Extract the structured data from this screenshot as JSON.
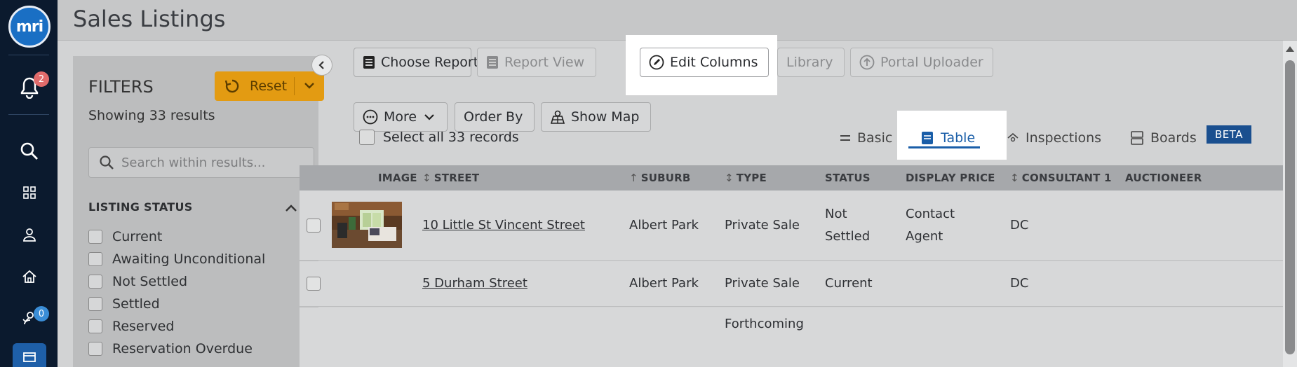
{
  "app": {
    "logo_text": "mri",
    "notification_count": "2",
    "tasks_count": "0"
  },
  "header": {
    "title": "Sales Listings"
  },
  "filters": {
    "title": "FILTERS",
    "reset_label": "Reset",
    "result_count": "Showing 33 results",
    "search_placeholder": "Search within results...",
    "section_title": "LISTING STATUS",
    "options": [
      {
        "label": "Current",
        "checked": false
      },
      {
        "label": "Awaiting Unconditional",
        "checked": false
      },
      {
        "label": "Not Settled",
        "checked": false
      },
      {
        "label": "Settled",
        "checked": false
      },
      {
        "label": "Reserved",
        "checked": false
      },
      {
        "label": "Reservation Overdue",
        "checked": false
      }
    ]
  },
  "toolbar": {
    "choose_report": "Choose Report",
    "report_view": "Report View",
    "edit_columns": "Edit Columns",
    "library": "Library",
    "portal_uploader": "Portal Uploader",
    "more": "More",
    "order_by": "Order By",
    "show_map": "Show Map"
  },
  "selection": {
    "select_all_label": "Select all 33 records"
  },
  "views": {
    "basic": "Basic",
    "table": "Table",
    "inspections": "Inspections",
    "boards": "Boards",
    "beta_badge": "BETA",
    "active": "Table"
  },
  "table": {
    "columns": [
      "IMAGE",
      "STREET",
      "SUBURB",
      "TYPE",
      "STATUS",
      "DISPLAY PRICE",
      "CONSULTANT 1",
      "AUCTIONEER"
    ],
    "rows": [
      {
        "street": "10 Little St Vincent Street",
        "suburb": "Albert Park",
        "type": "Private Sale",
        "status": "Not Settled",
        "price": "Contact Agent",
        "consultant": "DC",
        "auctioneer": "",
        "has_image": true
      },
      {
        "street": "5 Durham Street",
        "suburb": "Albert Park",
        "type": "Private Sale",
        "status": "Current",
        "price": "",
        "consultant": "DC",
        "auctioneer": "",
        "has_image": false
      },
      {
        "street": "",
        "suburb": "",
        "type": "Forthcoming",
        "status": "",
        "price": "",
        "consultant": "",
        "auctioneer": "",
        "has_image": false
      }
    ]
  },
  "colors": {
    "accent_blue": "#1a5ea8",
    "reset_orange": "#e39b12",
    "rail_dark": "#0b1a2e"
  }
}
